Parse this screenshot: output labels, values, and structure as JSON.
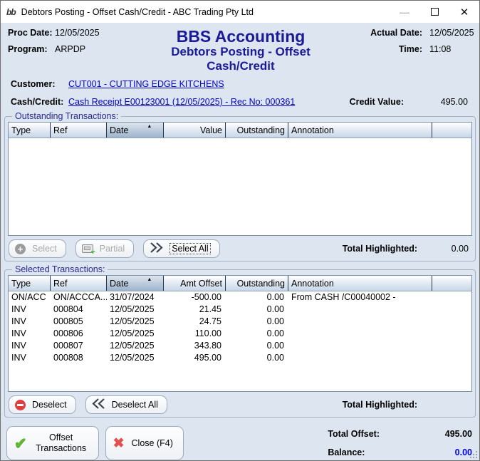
{
  "window": {
    "title": "Debtors Posting - Offset Cash/Credit - ABC Trading Pty Ltd",
    "app_icon_text": "bb",
    "controls": {
      "minimize": "—",
      "close": "✕"
    }
  },
  "header": {
    "proc_date_label": "Proc Date:",
    "proc_date": "12/05/2025",
    "program_label": "Program:",
    "program": "ARPDP",
    "app_title": "BBS Accounting",
    "screen_title": "Debtors Posting - Offset Cash/Credit",
    "actual_date_label": "Actual Date:",
    "actual_date": "12/05/2025",
    "time_label": "Time:",
    "time": "11:08"
  },
  "details": {
    "customer_label": "Customer:",
    "customer_link": "CUT001 - CUTTING EDGE KITCHENS",
    "cash_credit_label": "Cash/Credit:",
    "cash_credit_link": "Cash Receipt E00123001 (12/05/2025) - Rec No: 000361",
    "credit_value_label": "Credit Value:",
    "credit_value": "495.00"
  },
  "outstanding": {
    "group_label": "Outstanding Transactions:",
    "columns": [
      "Type",
      "Ref",
      "Date",
      "Value",
      "Outstanding",
      "Annotation"
    ],
    "sort_column": "Date",
    "sort_arrow": "▲",
    "rows": [],
    "buttons": {
      "select": "Select",
      "partial": "Partial",
      "select_all": "Select All"
    },
    "total_highlighted_label": "Total Highlighted:",
    "total_highlighted": "0.00"
  },
  "selected": {
    "group_label": "Selected Transactions:",
    "columns": [
      "Type",
      "Ref",
      "Date",
      "Amt Offset",
      "Outstanding",
      "Annotation"
    ],
    "sort_column": "Date",
    "sort_arrow": "▲",
    "rows": [
      [
        "ON/ACC",
        "ON/ACCCA...",
        "31/07/2024",
        "-500.00",
        "0.00",
        "From CASH  /C00040002 -"
      ],
      [
        "INV",
        "000804",
        "12/05/2025",
        "21.45",
        "0.00",
        ""
      ],
      [
        "INV",
        "000805",
        "12/05/2025",
        "24.75",
        "0.00",
        ""
      ],
      [
        "INV",
        "000806",
        "12/05/2025",
        "110.00",
        "0.00",
        ""
      ],
      [
        "INV",
        "000807",
        "12/05/2025",
        "343.80",
        "0.00",
        ""
      ],
      [
        "INV",
        "000808",
        "12/05/2025",
        "495.00",
        "0.00",
        ""
      ]
    ],
    "buttons": {
      "deselect": "Deselect",
      "deselect_all": "Deselect All"
    },
    "total_highlighted_label": "Total Highlighted:",
    "total_highlighted": ""
  },
  "footer": {
    "offset_button": "Offset Transactions",
    "close_button": "Close (F4)",
    "total_offset_label": "Total Offset:",
    "total_offset": "495.00",
    "balance_label": "Balance:",
    "balance": "0.00"
  },
  "colors": {
    "accent_navy": "#1b1b98",
    "link_blue": "#0404c6",
    "balance_blue": "#0000ee"
  }
}
